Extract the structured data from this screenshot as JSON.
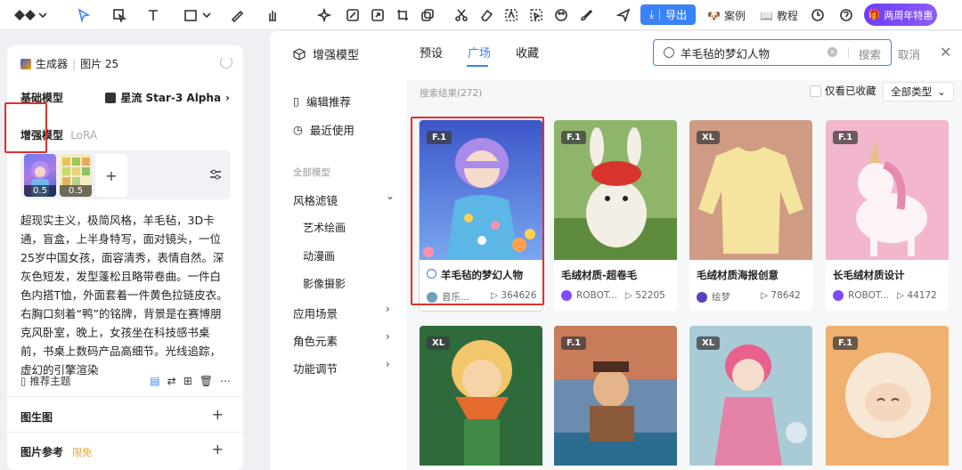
{
  "toolbar": {
    "export_label": "导出",
    "cases_label": "案例",
    "tutorial_label": "教程",
    "promo_label": "两周年特惠",
    "icons": [
      "logo-icon",
      "chevron-down-icon",
      "cursor-icon",
      "select-icon",
      "text-icon",
      "rect-icon",
      "pen-icon",
      "hand-icon",
      "sparkle-icon",
      "edit-icon",
      "expand-icon",
      "crop-icon",
      "layers-icon",
      "scissors-icon",
      "eraser-icon",
      "text-detect-icon",
      "select-subject-icon",
      "palette-icon",
      "brush-icon",
      "send-icon",
      "clock-icon",
      "help-icon"
    ]
  },
  "left_panel": {
    "title": "生成器",
    "subtitle": "图片 25",
    "base_model_label": "基础模型",
    "base_model_value": "星流 Star-3 Alpha",
    "enhance_label": "增强模型",
    "enhance_tag": "LoRA",
    "lora_weights": [
      "0.5",
      "0.5"
    ],
    "prompt": "超现实主义，极简风格，羊毛毡，3D卡通，盲盒，上半身特写，面对镜头，一位25岁中国女孩，面容清秀，表情自然。深灰色短发，发型蓬松且略带卷曲。一件白色内搭T恤，外面套着一件黄色拉链皮衣。右胸口刻着“鸭”的铭牌，背景是在赛博朋克风卧室，晚上，女孩坐在科技感书桌前，书桌上数码产品高细节。光线追踪，虚幻的引擎渲染",
    "recommend_label": "推荐主题",
    "section_img2img": "图生图",
    "section_imgref": "图片参考",
    "free_tag": "限免"
  },
  "overlay": {
    "title": "增强模型",
    "tabs": [
      "预设",
      "广场",
      "收藏"
    ],
    "active_tab": "广场",
    "search_query": "羊毛毡的梦幻人物",
    "search_button": "搜索",
    "cancel_label": "取消",
    "nav": {
      "featured": "编辑推荐",
      "recent": "最近使用",
      "all_models": "全部模型",
      "style_filter": "风格滤镜",
      "sub_art": "艺术绘画",
      "sub_anime": "动漫画",
      "sub_photo": "影像摄影",
      "scene": "应用场景",
      "character": "角色元素",
      "function": "功能调节"
    },
    "result_count": "搜索结果(272)",
    "only_fav_label": "仅看已收藏",
    "all_types_label": "全部类型",
    "cards": [
      {
        "badge": "F.1",
        "name": "羊毛毡的梦幻人物",
        "author": "音乐...",
        "views": "364626"
      },
      {
        "badge": "F.1",
        "name": "毛绒材质-超卷毛",
        "author": "ROBOT...",
        "views": "52205"
      },
      {
        "badge": "XL",
        "name": "毛绒材质海报创意",
        "author": "绘梦",
        "views": "78642"
      },
      {
        "badge": "F.1",
        "name": "长毛绒材质设计",
        "author": "ROBOT...",
        "views": "44172"
      },
      {
        "badge": "XL",
        "name": "",
        "author": "",
        "views": ""
      },
      {
        "badge": "F.1",
        "name": "",
        "author": "",
        "views": ""
      },
      {
        "badge": "XL",
        "name": "",
        "author": "",
        "views": ""
      },
      {
        "badge": "F.1",
        "name": "",
        "author": "",
        "views": ""
      }
    ]
  }
}
